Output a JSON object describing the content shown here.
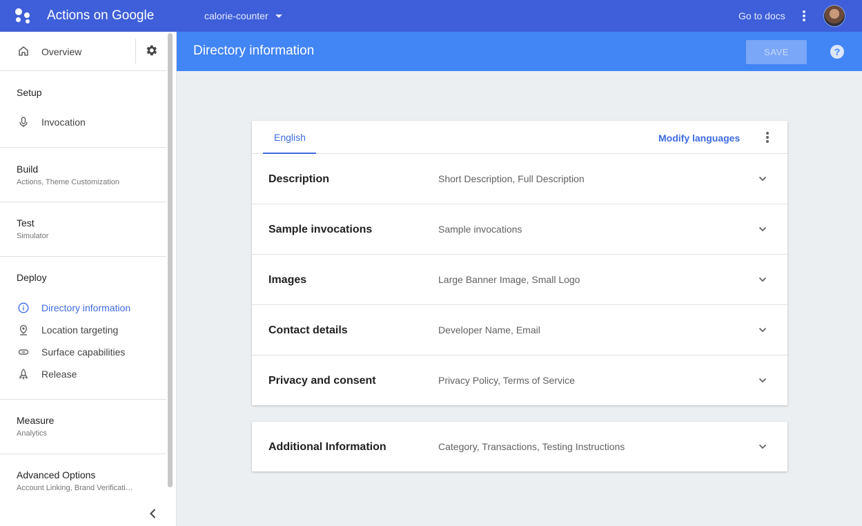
{
  "app": {
    "title": "Actions on Google",
    "project": "calorie-counter",
    "docs_link": "Go to docs"
  },
  "sidebar": {
    "overview": "Overview",
    "setup": {
      "heading": "Setup",
      "items": [
        {
          "label": "Invocation",
          "icon": "microphone-icon"
        }
      ]
    },
    "build": {
      "heading": "Build",
      "sub": "Actions, Theme Customization"
    },
    "test": {
      "heading": "Test",
      "sub": "Simulator"
    },
    "deploy": {
      "heading": "Deploy",
      "items": [
        {
          "label": "Directory information",
          "icon": "info-icon",
          "active": true
        },
        {
          "label": "Location targeting",
          "icon": "location-pin-icon"
        },
        {
          "label": "Surface capabilities",
          "icon": "link-icon"
        },
        {
          "label": "Release",
          "icon": "rocket-icon"
        }
      ]
    },
    "measure": {
      "heading": "Measure",
      "sub": "Analytics"
    },
    "advanced": {
      "heading": "Advanced Options",
      "sub": "Account Linking, Brand Verificati…"
    }
  },
  "page": {
    "title": "Directory information",
    "save_label": "SAVE",
    "help_label": "?"
  },
  "card": {
    "tab_label": "English",
    "modify_languages": "Modify languages",
    "rows": [
      {
        "title": "Description",
        "summary": "Short Description, Full Description"
      },
      {
        "title": "Sample invocations",
        "summary": "Sample invocations"
      },
      {
        "title": "Images",
        "summary": "Large Banner Image, Small Logo"
      },
      {
        "title": "Contact details",
        "summary": "Developer Name, Email"
      },
      {
        "title": "Privacy and consent",
        "summary": "Privacy Policy, Terms of Service"
      }
    ]
  },
  "extra_card": {
    "title": "Additional Information",
    "summary": "Category, Transactions, Testing Instructions"
  },
  "colors": {
    "topbar": "#3e5fd9",
    "header": "#4285f4",
    "accent": "#3d6be0",
    "background": "#eceff1"
  }
}
